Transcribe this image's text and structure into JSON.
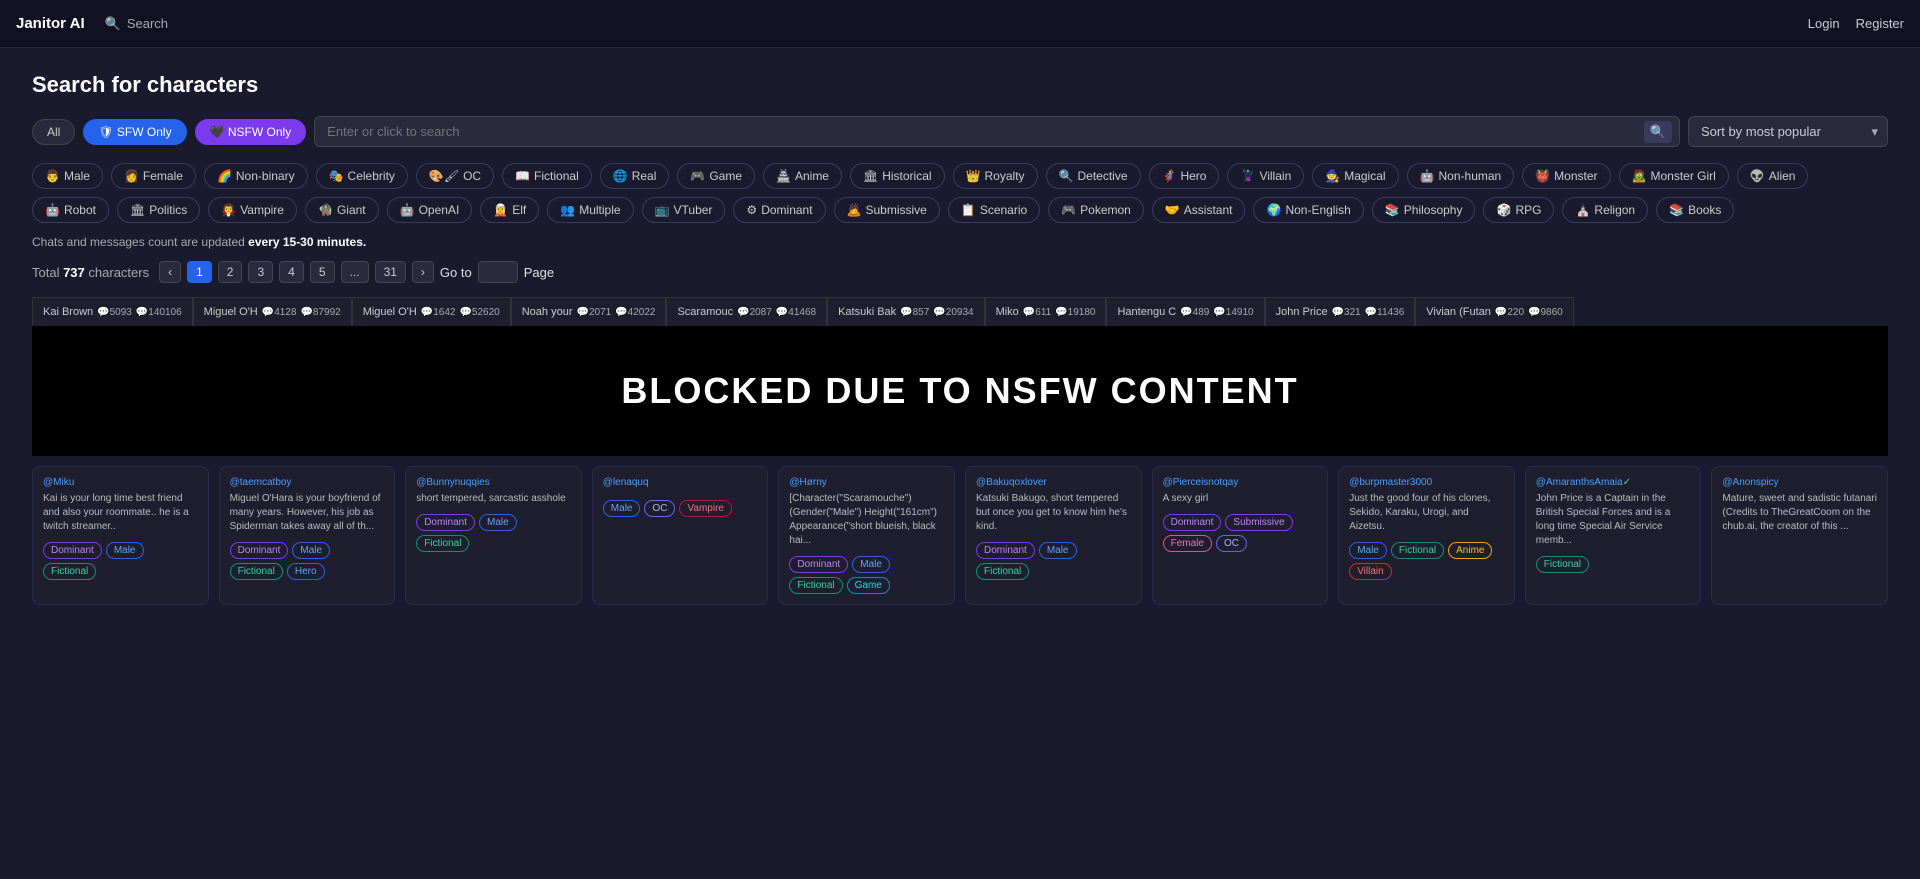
{
  "nav": {
    "logo": "Janitor AI",
    "search_label": "Search",
    "login": "Login",
    "register": "Register"
  },
  "header": {
    "title": "Search for characters"
  },
  "filters": {
    "all": "All",
    "sfw_only": "SFW Only",
    "nsfw_only": "NSFW Only",
    "search_placeholder": "Enter or click to search",
    "sort_label": "Sort by most popular"
  },
  "tags": [
    {
      "emoji": "👨",
      "label": "Male"
    },
    {
      "emoji": "👩",
      "label": "Female"
    },
    {
      "emoji": "🌈",
      "label": "Non-binary"
    },
    {
      "emoji": "🎭",
      "label": "Celebrity"
    },
    {
      "emoji": "🎨🖌",
      "label": "OC"
    },
    {
      "emoji": "📖",
      "label": "Fictional"
    },
    {
      "emoji": "🌐",
      "label": "Real"
    },
    {
      "emoji": "🎮",
      "label": "Game"
    },
    {
      "emoji": "🏯",
      "label": "Anime"
    },
    {
      "emoji": "🏛",
      "label": "Historical"
    },
    {
      "emoji": "👑",
      "label": "Royalty"
    },
    {
      "emoji": "🔍",
      "label": "Detective"
    },
    {
      "emoji": "🦸",
      "label": "Hero"
    },
    {
      "emoji": "🦹",
      "label": "Villain"
    },
    {
      "emoji": "🧙",
      "label": "Magical"
    },
    {
      "emoji": "🤖",
      "label": "Non-human"
    },
    {
      "emoji": "👹",
      "label": "Monster"
    },
    {
      "emoji": "🧟",
      "label": "Monster Girl"
    },
    {
      "emoji": "👽",
      "label": "Alien"
    },
    {
      "emoji": "🤖",
      "label": "Robot"
    },
    {
      "emoji": "🏛",
      "label": "Politics"
    },
    {
      "emoji": "🧛",
      "label": "Vampire"
    },
    {
      "emoji": "🧌",
      "label": "Giant"
    },
    {
      "emoji": "🤖",
      "label": "OpenAI"
    },
    {
      "emoji": "🧝",
      "label": "Elf"
    },
    {
      "emoji": "👥",
      "label": "Multiple"
    },
    {
      "emoji": "📺",
      "label": "VTuber"
    },
    {
      "emoji": "⚙",
      "label": "Dominant"
    },
    {
      "emoji": "🙇",
      "label": "Submissive"
    },
    {
      "emoji": "📋",
      "label": "Scenario"
    },
    {
      "emoji": "🎮",
      "label": "Pokemon"
    },
    {
      "emoji": "🤝",
      "label": "Assistant"
    },
    {
      "emoji": "🌍",
      "label": "Non-English"
    },
    {
      "emoji": "📚",
      "label": "Philosophy"
    },
    {
      "emoji": "🎲",
      "label": "RPG"
    },
    {
      "emoji": "⛪",
      "label": "Religon"
    },
    {
      "emoji": "📚",
      "label": "Books"
    }
  ],
  "info": {
    "text_before": "Chats and messages count are updated ",
    "emphasis": "every 15-30 minutes.",
    "text_after": ""
  },
  "pagination": {
    "total_label": "Total",
    "total_count": "737",
    "characters_label": "characters",
    "pages": [
      "1",
      "2",
      "3",
      "4",
      "5",
      "...",
      "31"
    ],
    "goto_label": "Go to",
    "page_label": "Page",
    "current": "1"
  },
  "char_tabs": [
    {
      "name": "Kai Brown",
      "chats": "5093",
      "msgs": "140106"
    },
    {
      "name": "Miguel O'H",
      "chats": "4128",
      "msgs": "87992"
    },
    {
      "name": "Miguel O'H",
      "chats": "1642",
      "msgs": "52620"
    },
    {
      "name": "Noah your",
      "chats": "2071",
      "msgs": "42022"
    },
    {
      "name": "Scaramouc",
      "chats": "2087",
      "msgs": "41468"
    },
    {
      "name": "Katsuki Bak",
      "chats": "857",
      "msgs": "20934"
    },
    {
      "name": "Miko",
      "chats": "611",
      "msgs": "19180"
    },
    {
      "name": "Hantengu C",
      "chats": "489",
      "msgs": "14910"
    },
    {
      "name": "John Price",
      "chats": "321",
      "msgs": "11436"
    },
    {
      "name": "Vivian (Futan",
      "chats": "220",
      "msgs": "9860"
    }
  ],
  "blocked": {
    "text": "BLOCKED DUE TO NSFW CONTENT"
  },
  "cards": [
    {
      "author": "@Miku",
      "verified": false,
      "desc": "Kai is your long time best friend and also your roommate.. he is a twitch streamer..",
      "tags": [
        {
          "type": "dominant",
          "label": "Dominant"
        },
        {
          "type": "male",
          "label": "Male"
        },
        {
          "type": "fictional",
          "label": "Fictional"
        }
      ]
    },
    {
      "author": "@taemcatboy",
      "verified": false,
      "desc": "Miguel O'Hara is your boyfriend of many years. However, his job as Spiderman takes away all of th...",
      "tags": [
        {
          "type": "dominant",
          "label": "Dominant"
        },
        {
          "type": "male",
          "label": "Male"
        },
        {
          "type": "fictional",
          "label": "Fictional"
        },
        {
          "type": "hero",
          "label": "Hero"
        }
      ]
    },
    {
      "author": "@Bunnynuqqies",
      "verified": false,
      "desc": "short tempered, sarcastic asshole",
      "tags": [
        {
          "type": "dominant",
          "label": "Dominant"
        },
        {
          "type": "male",
          "label": "Male"
        },
        {
          "type": "fictional",
          "label": "Fictional"
        }
      ]
    },
    {
      "author": "@lenaquq",
      "verified": false,
      "desc": "",
      "tags": [
        {
          "type": "male",
          "label": "Male"
        },
        {
          "type": "oc",
          "label": "OC"
        },
        {
          "type": "vampire",
          "label": "Vampire"
        }
      ]
    },
    {
      "author": "@Hørny",
      "verified": false,
      "desc": "[Character(\"Scaramouche\") (Gender(\"Male\") Height(\"161cm\") Appearance(\"short blueish, black hai...",
      "tags": [
        {
          "type": "dominant",
          "label": "Dominant"
        },
        {
          "type": "male",
          "label": "Male"
        },
        {
          "type": "fictional",
          "label": "Fictional"
        },
        {
          "type": "game",
          "label": "Game"
        }
      ]
    },
    {
      "author": "@Bakuqoxlover",
      "verified": false,
      "desc": "Katsuki Bakugo, short tempered but once you get to know him he's kind.",
      "tags": [
        {
          "type": "dominant",
          "label": "Dominant"
        },
        {
          "type": "male",
          "label": "Male"
        },
        {
          "type": "fictional",
          "label": "Fictional"
        }
      ]
    },
    {
      "author": "@Pierceisnotqay",
      "verified": false,
      "desc": "A sexy girl",
      "tags": [
        {
          "type": "dominant",
          "label": "Dominant"
        },
        {
          "type": "submissive",
          "label": "Submissive"
        },
        {
          "type": "female",
          "label": "Female"
        },
        {
          "type": "oc",
          "label": "OC"
        }
      ]
    },
    {
      "author": "@burpmaster3000",
      "verified": false,
      "desc": "Just the good four of his clones, Sekido, Karaku, Urogi, and Aizetsu.",
      "tags": [
        {
          "type": "male",
          "label": "Male"
        },
        {
          "type": "fictional",
          "label": "Fictional"
        },
        {
          "type": "anime",
          "label": "Anime"
        },
        {
          "type": "villain",
          "label": "Villain"
        }
      ]
    },
    {
      "author": "@AmaranthsAmaia",
      "verified": true,
      "desc": "John Price is a Captain in the British Special Forces and is a long time Special Air Service memb...",
      "tags": [
        {
          "type": "fictional",
          "label": "Fictional"
        }
      ]
    },
    {
      "author": "@Anonspicy",
      "verified": false,
      "desc": "Mature, sweet and sadistic futanari (Credits to TheGreatCoom on the chub.ai, the creator of this ...",
      "tags": []
    }
  ]
}
